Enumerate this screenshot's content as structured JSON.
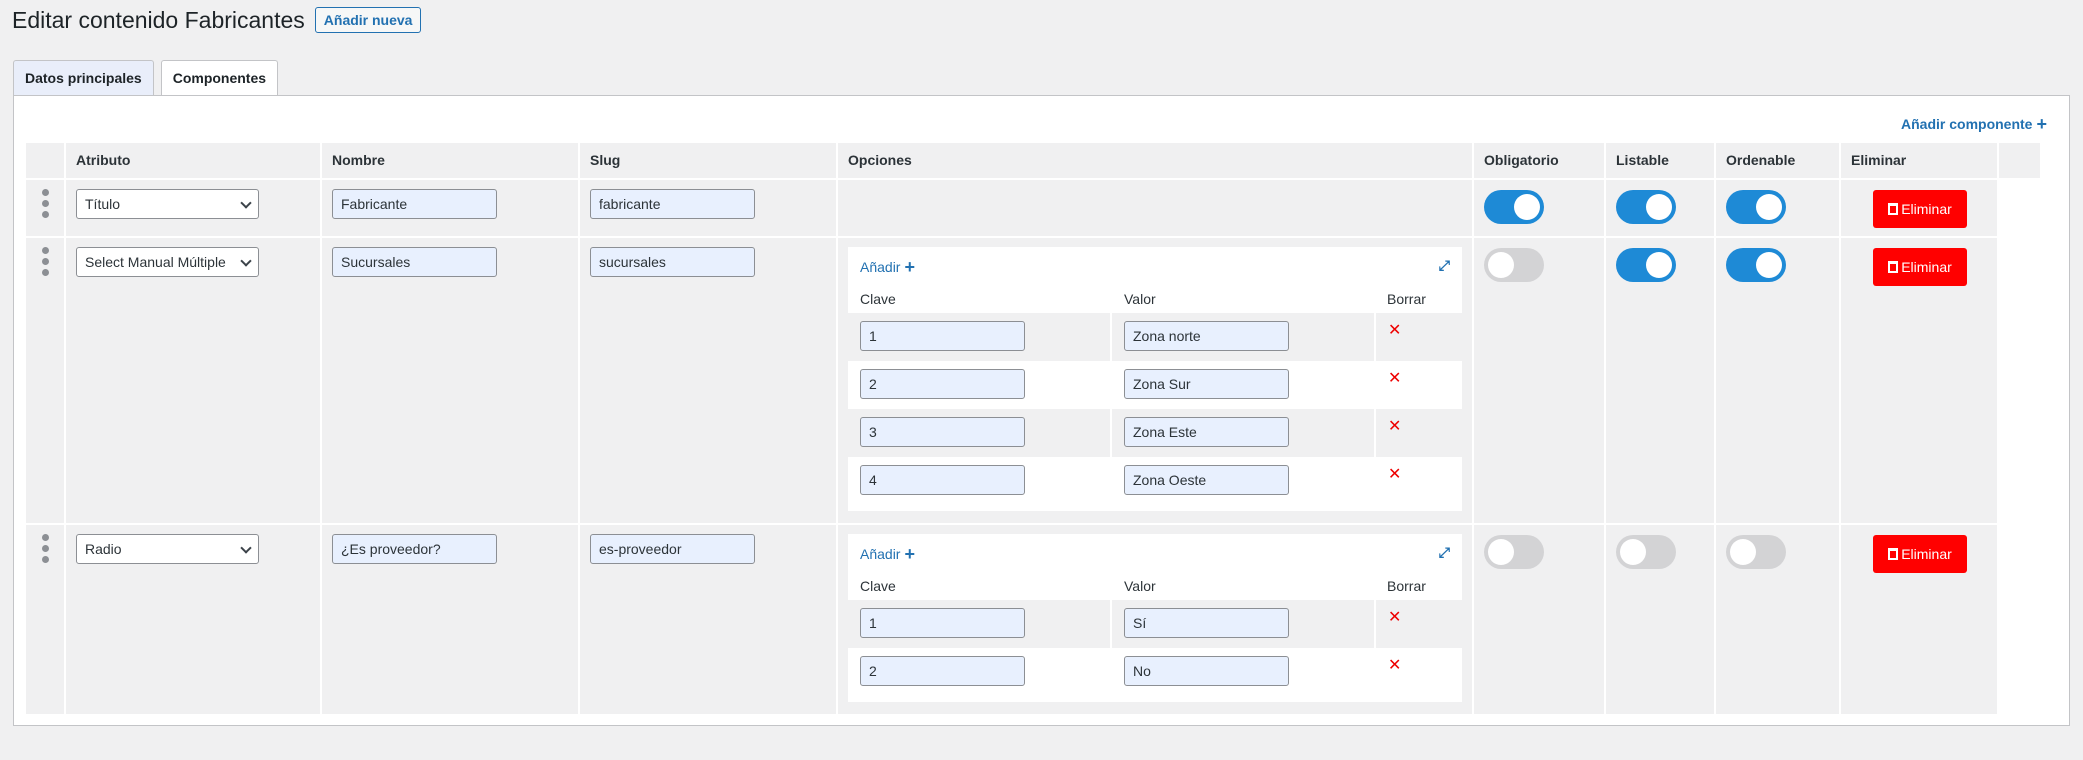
{
  "page": {
    "title": "Editar contenido Fabricantes",
    "add_new": "Añadir nueva"
  },
  "tabs": [
    {
      "label": "Datos principales",
      "active": false
    },
    {
      "label": "Componentes",
      "active": true
    }
  ],
  "panel": {
    "add_component": "Añadir componente",
    "columns": [
      "Atributo",
      "Nombre",
      "Slug",
      "Opciones",
      "Obligatorio",
      "Listable",
      "Ordenable",
      "Eliminar"
    ],
    "delete_label": "Eliminar",
    "options_add": "Añadir",
    "options_cols": [
      "Clave",
      "Valor",
      "Borrar"
    ],
    "rows": [
      {
        "atributo": "Título",
        "nombre": "Fabricante",
        "slug": "fabricante",
        "obligatorio": true,
        "listable": true,
        "ordenable": true
      },
      {
        "atributo": "Select Manual Múltiple",
        "nombre": "Sucursales",
        "slug": "sucursales",
        "obligatorio": false,
        "listable": true,
        "ordenable": true,
        "options": [
          {
            "clave": "1",
            "valor": "Zona norte"
          },
          {
            "clave": "2",
            "valor": "Zona Sur"
          },
          {
            "clave": "3",
            "valor": "Zona Este"
          },
          {
            "clave": "4",
            "valor": "Zona Oeste"
          }
        ]
      },
      {
        "atributo": "Radio",
        "nombre": "¿Es proveedor?",
        "slug": "es-proveedor",
        "obligatorio": false,
        "listable": false,
        "ordenable": false,
        "options": [
          {
            "clave": "1",
            "valor": "Sí"
          },
          {
            "clave": "2",
            "valor": "No"
          }
        ]
      }
    ]
  },
  "colors": {
    "accent": "#2271b1",
    "toggle_on": "#1e8ad6",
    "delete": "#ff0000"
  },
  "icons": [
    "plus-icon",
    "chevron-down-icon",
    "drag-handle-icon",
    "trash-icon",
    "expand-icon",
    "close-icon"
  ]
}
